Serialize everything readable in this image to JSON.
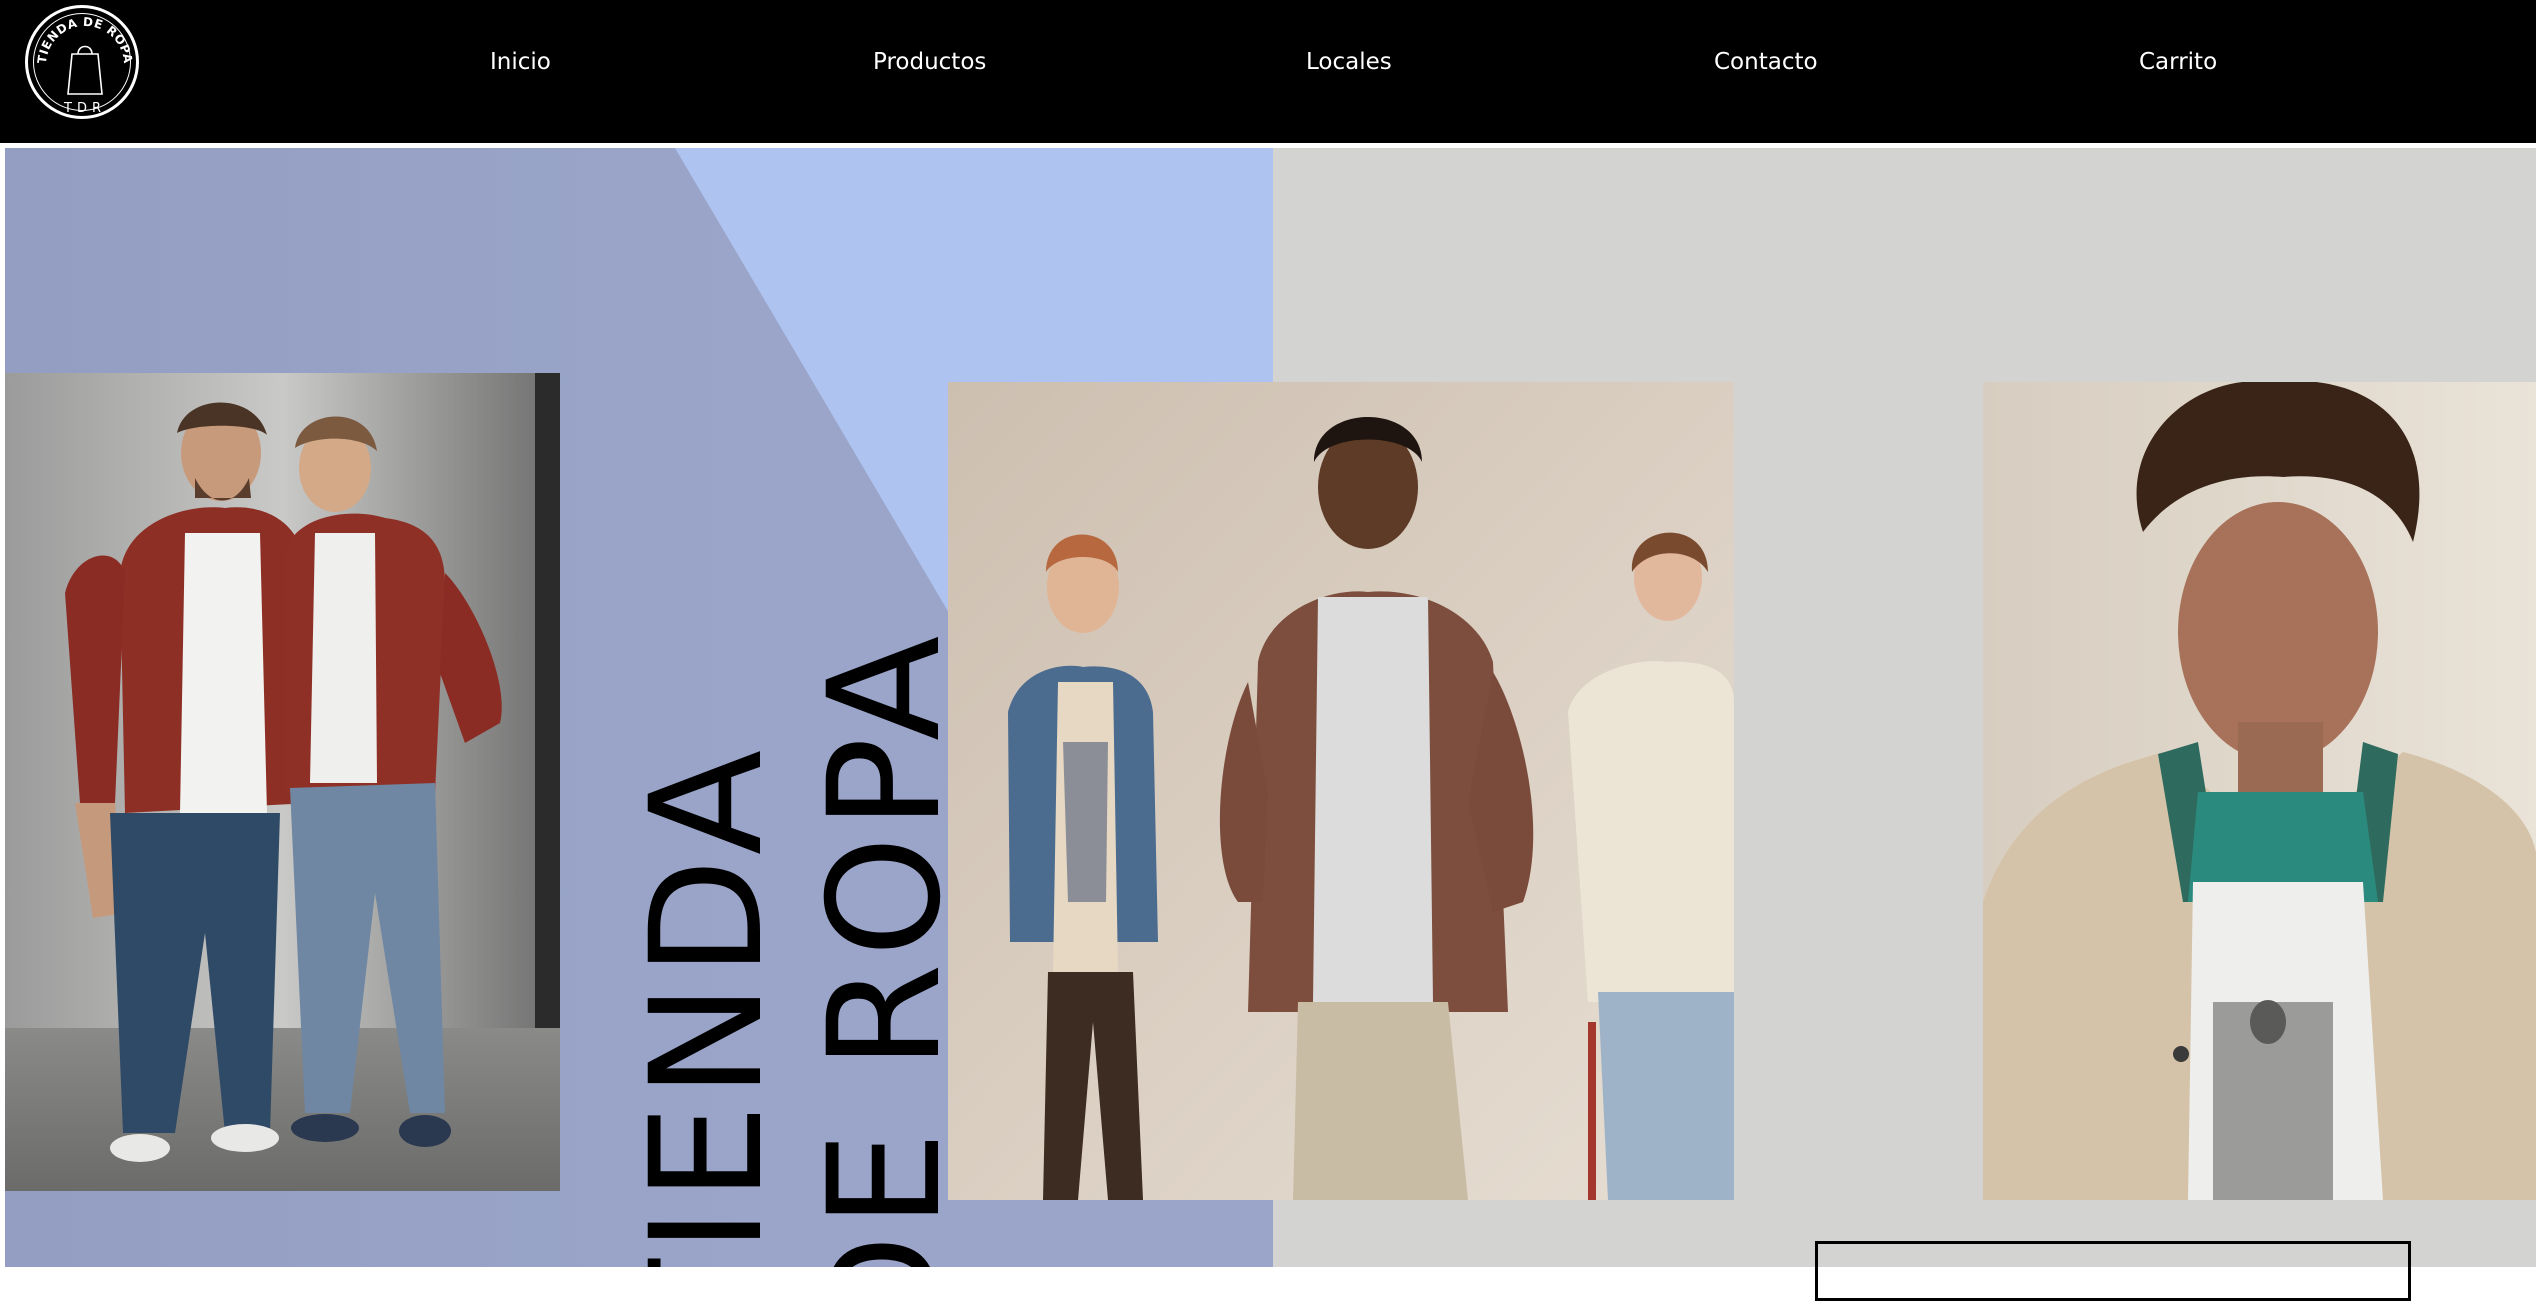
{
  "brand": {
    "logo_text_top": "TIENDA DE ROPA",
    "logo_text_bottom": "TDR",
    "logo_icon": "shopping-bag-icon"
  },
  "nav": {
    "items": [
      {
        "label": "Inicio"
      },
      {
        "label": "Productos"
      },
      {
        "label": "Locales"
      },
      {
        "label": "Contacto"
      },
      {
        "label": "Carrito"
      }
    ]
  },
  "hero": {
    "title_line1": "TIENDA",
    "title_line2": "DE ROPA",
    "colors": {
      "left_panel": "#9aa5c9",
      "left_panel_light": "#aec3ef",
      "right_panel": "#d3d3d1",
      "header": "#000000"
    }
  }
}
